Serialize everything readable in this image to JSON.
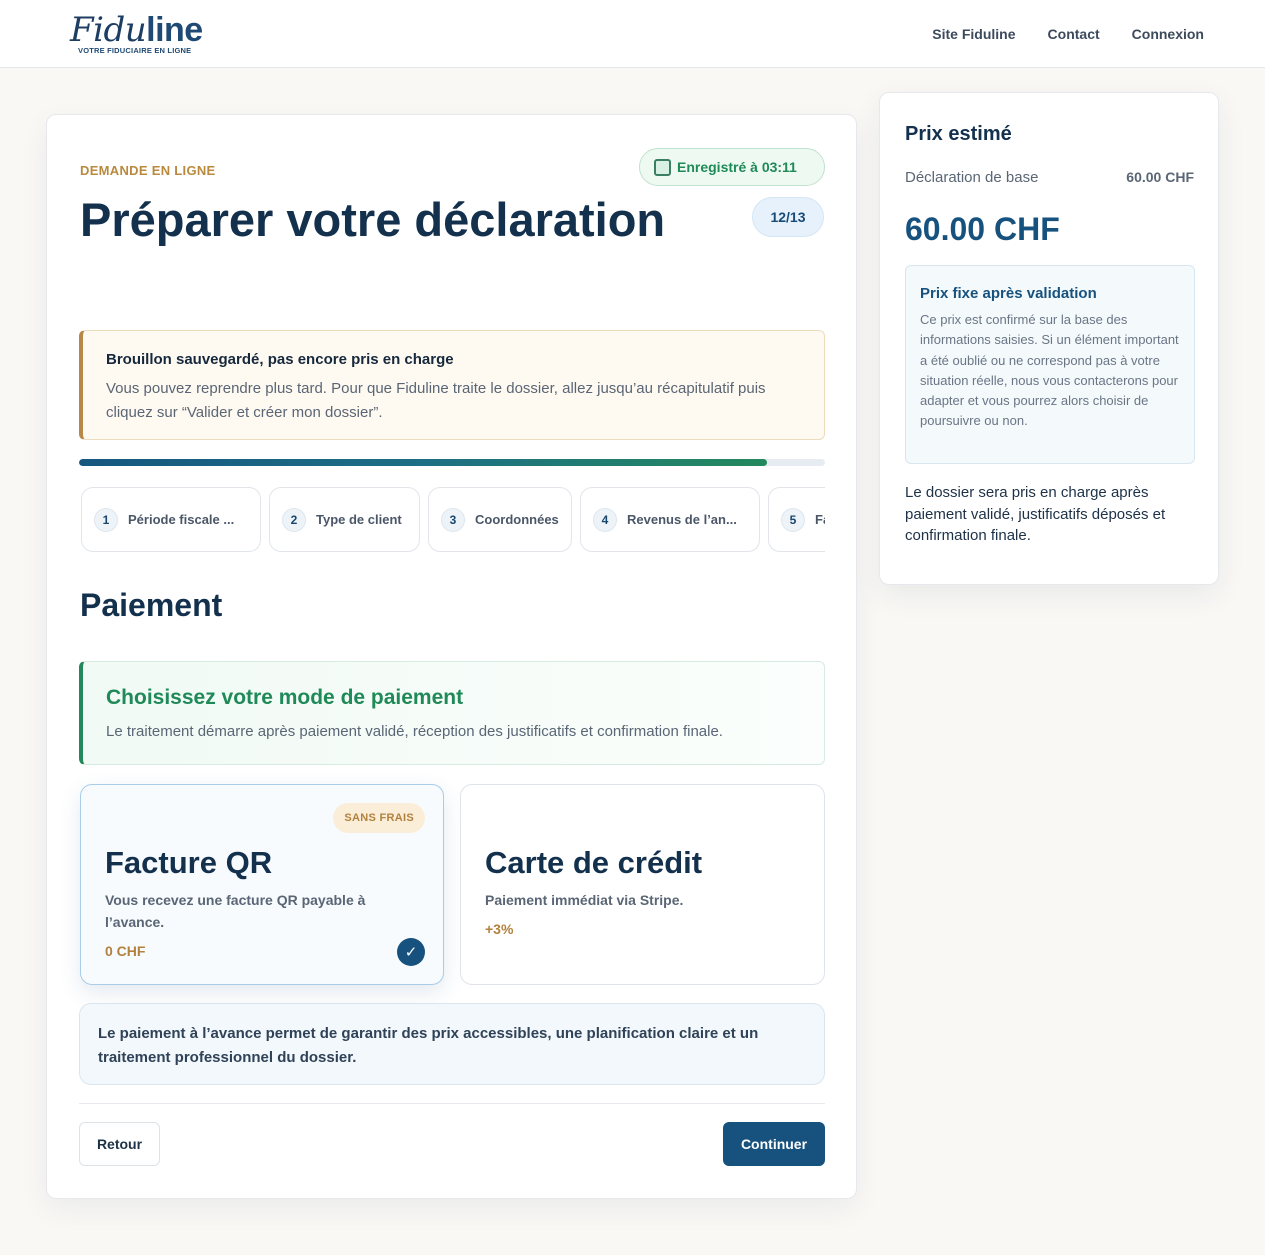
{
  "header": {
    "logo_part1": "Fidu",
    "logo_part2": "line",
    "logo_tagline": "VOTRE FIDUCIAIRE EN LIGNE",
    "nav": [
      "Site Fiduline",
      "Contact",
      "Connexion"
    ]
  },
  "form": {
    "eyebrow": "DEMANDE EN LIGNE",
    "saved_status": "Enregistré à 03:11",
    "title": "Préparer votre déclaration",
    "step_counter": "12/13",
    "progress_fraction": 0.922,
    "notice": {
      "title": "Brouillon sauvegardé, pas encore pris en charge",
      "text": "Vous pouvez reprendre plus tard. Pour que Fiduline traite le dossier, allez jusqu’au récapitulatif puis cliquez sur “Valider et créer mon dossier”."
    },
    "steps": [
      {
        "num": "1",
        "label": "Période fiscale ..."
      },
      {
        "num": "2",
        "label": "Type de client"
      },
      {
        "num": "3",
        "label": "Coordonnées"
      },
      {
        "num": "4",
        "label": "Revenus de l’an..."
      },
      {
        "num": "5",
        "label": "Fa..."
      }
    ],
    "section_title": "Paiement",
    "pay_intro": {
      "title": "Choisissez votre mode de paiement",
      "text": "Le traitement démarre après paiement validé, réception des justificatifs et confirmation finale."
    },
    "options": {
      "qr": {
        "badge": "SANS FRAIS",
        "title": "Facture QR",
        "desc": "Vous recevez une facture QR payable à l’avance.",
        "price": "0 CHF",
        "check": "✓"
      },
      "card": {
        "title": "Carte de crédit",
        "desc": "Paiement immédiat via Stripe.",
        "price": "+3%"
      }
    },
    "info": "Le paiement à l’avance permet de garantir des prix accessibles, une planification claire et un traitement professionnel du dossier.",
    "back_label": "Retour",
    "next_label": "Continuer"
  },
  "side": {
    "title": "Prix estimé",
    "base_label": "Déclaration de base",
    "base_value": "60.00 CHF",
    "total": "60.00 CHF",
    "fixed_title": "Prix fixe après validation",
    "fixed_text": "Ce prix est confirmé sur la base des informations saisies. Si un élément important a été oublié ou ne correspond pas à votre situation réelle, nous vous contacterons pour adapter et vous pourrez alors choisir de poursuivre ou non.",
    "note": "Le dossier sera pris en charge après paiement validé, justificatifs déposés et confirmation finale."
  },
  "colors": {
    "primary": "#17527f",
    "accent_gold": "#b8884a",
    "accent_green": "#23895d"
  }
}
